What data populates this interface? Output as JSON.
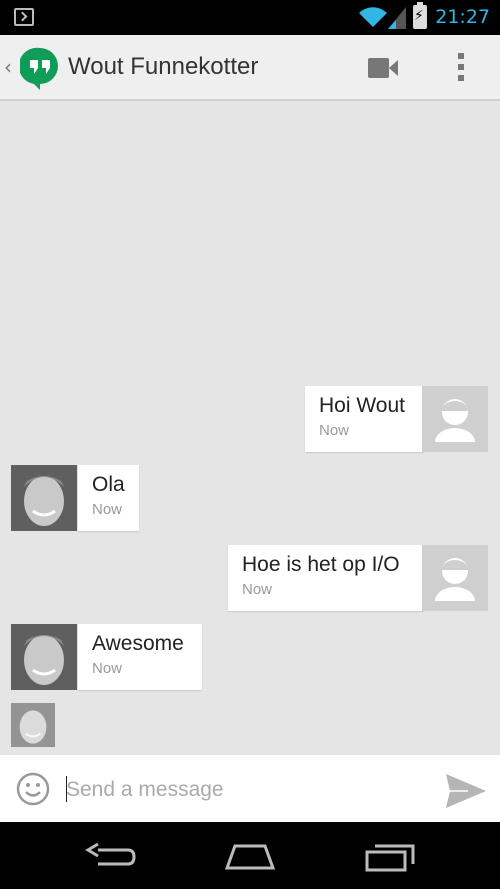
{
  "status_bar": {
    "time": "21:27",
    "icons": [
      "terminal-icon",
      "wifi-icon",
      "signal-icon",
      "battery-charging-icon"
    ]
  },
  "action_bar": {
    "title": "Wout Funnekotter",
    "app_icon": "hangouts-icon",
    "actions": [
      "video-call-icon",
      "overflow-menu-icon"
    ]
  },
  "messages": [
    {
      "text": "Hoi Wout",
      "time": "Now",
      "side": "outgoing"
    },
    {
      "text": "Ola",
      "time": "Now",
      "side": "incoming"
    },
    {
      "text": "Hoe is het op I/O",
      "time": "Now",
      "side": "outgoing"
    },
    {
      "text": "Awesome",
      "time": "Now",
      "side": "incoming"
    }
  ],
  "composer": {
    "placeholder": "Send a message",
    "value": ""
  },
  "nav_bar": [
    "back-icon",
    "home-icon",
    "recent-apps-icon"
  ],
  "colors": {
    "accent": "#33b5e5",
    "hangouts_green": "#0f9d58",
    "background": "#e5e5e5"
  }
}
